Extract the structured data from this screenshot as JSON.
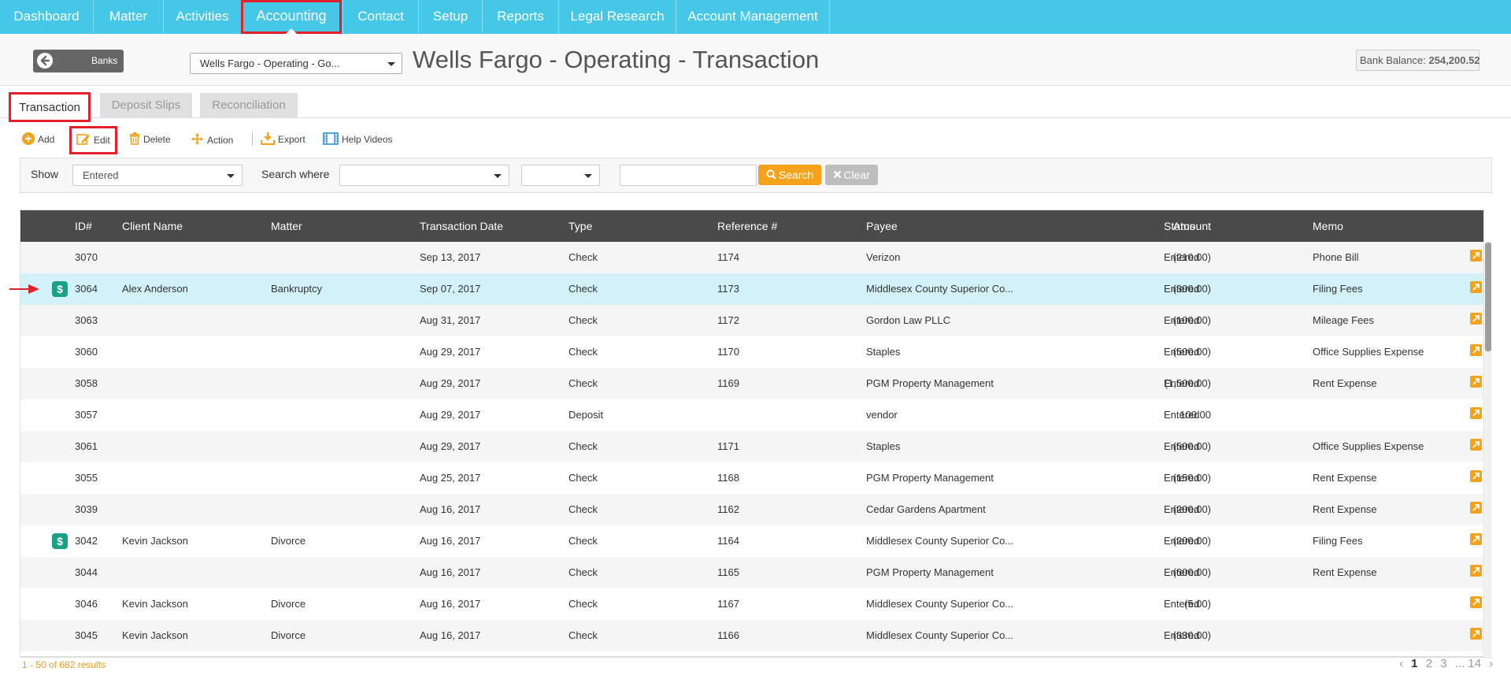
{
  "nav": {
    "items": [
      "Dashboard",
      "Matter",
      "Activities",
      "Accounting",
      "Contact",
      "Setup",
      "Reports",
      "Legal Research",
      "Account Management"
    ],
    "active": "Accounting"
  },
  "header": {
    "back_button": "Banks",
    "account_select": "Wells Fargo - Operating - Go...",
    "title": "Wells Fargo - Operating - Transaction",
    "balance_label": "Bank Balance:",
    "balance_value": "254,200.52"
  },
  "tabs": [
    {
      "label": "Transaction",
      "active": true
    },
    {
      "label": "Deposit Slips",
      "active": false
    },
    {
      "label": "Reconciliation",
      "active": false
    }
  ],
  "toolbar": {
    "add": "Add",
    "edit": "Edit",
    "delete": "Delete",
    "action": "Action",
    "export": "Export",
    "help_videos": "Help Videos"
  },
  "filter": {
    "show_label": "Show",
    "show_value": "Entered",
    "search_where_label": "Search where",
    "search_field_value": "",
    "operator_value": "",
    "search_text": "",
    "search_button": "Search",
    "clear_button": "Clear"
  },
  "table": {
    "columns": [
      "ID#",
      "Client Name",
      "Matter",
      "Transaction Date",
      "Type",
      "Reference #",
      "Payee",
      "Amount",
      "Status",
      "Memo"
    ],
    "rows": [
      {
        "id": "3070",
        "client": "",
        "matter": "",
        "date": "Sep 13, 2017",
        "type": "Check",
        "ref": "1174",
        "payee": "Verizon",
        "amount": "(210.00)",
        "status": "Entered",
        "memo": "Phone Bill",
        "money": false,
        "selected": false
      },
      {
        "id": "3064",
        "client": "Alex Anderson",
        "matter": "Bankruptcy",
        "date": "Sep 07, 2017",
        "type": "Check",
        "ref": "1173",
        "payee": "Middlesex County Superior Co...",
        "amount": "(300.00)",
        "status": "Entered",
        "memo": "Filing Fees",
        "money": true,
        "selected": true
      },
      {
        "id": "3063",
        "client": "",
        "matter": "",
        "date": "Aug 31, 2017",
        "type": "Check",
        "ref": "1172",
        "payee": "Gordon Law PLLC",
        "amount": "(100.00)",
        "status": "Entered",
        "memo": "Mileage Fees",
        "money": false,
        "selected": false
      },
      {
        "id": "3060",
        "client": "",
        "matter": "",
        "date": "Aug 29, 2017",
        "type": "Check",
        "ref": "1170",
        "payee": "Staples",
        "amount": "(500.00)",
        "status": "Entered",
        "memo": "Office Supplies Expense",
        "money": false,
        "selected": false
      },
      {
        "id": "3058",
        "client": "",
        "matter": "",
        "date": "Aug 29, 2017",
        "type": "Check",
        "ref": "1169",
        "payee": "PGM Property Management",
        "amount": "(1,500.00)",
        "status": "Entered",
        "memo": "Rent Expense",
        "money": false,
        "selected": false
      },
      {
        "id": "3057",
        "client": "",
        "matter": "",
        "date": "Aug 29, 2017",
        "type": "Deposit",
        "ref": "",
        "payee": "vendor",
        "amount": "100.00",
        "status": "Entered",
        "memo": "",
        "money": false,
        "selected": false
      },
      {
        "id": "3061",
        "client": "",
        "matter": "",
        "date": "Aug 29, 2017",
        "type": "Check",
        "ref": "1171",
        "payee": "Staples",
        "amount": "(500.00)",
        "status": "Entered",
        "memo": "Office Supplies Expense",
        "money": false,
        "selected": false
      },
      {
        "id": "3055",
        "client": "",
        "matter": "",
        "date": "Aug 25, 2017",
        "type": "Check",
        "ref": "1168",
        "payee": "PGM Property Management",
        "amount": "(150.00)",
        "status": "Entered",
        "memo": "Rent Expense",
        "money": false,
        "selected": false
      },
      {
        "id": "3039",
        "client": "",
        "matter": "",
        "date": "Aug 16, 2017",
        "type": "Check",
        "ref": "1162",
        "payee": "Cedar Gardens Apartment",
        "amount": "(200.00)",
        "status": "Entered",
        "memo": "Rent Expense",
        "money": false,
        "selected": false
      },
      {
        "id": "3042",
        "client": "Kevin Jackson",
        "matter": "Divorce",
        "date": "Aug 16, 2017",
        "type": "Check",
        "ref": "1164",
        "payee": "Middlesex County Superior Co...",
        "amount": "(200.00)",
        "status": "Entered",
        "memo": "Filing Fees",
        "money": true,
        "selected": false
      },
      {
        "id": "3044",
        "client": "",
        "matter": "",
        "date": "Aug 16, 2017",
        "type": "Check",
        "ref": "1165",
        "payee": "PGM Property Management",
        "amount": "(600.00)",
        "status": "Entered",
        "memo": "Rent Expense",
        "money": false,
        "selected": false
      },
      {
        "id": "3046",
        "client": "Kevin Jackson",
        "matter": "Divorce",
        "date": "Aug 16, 2017",
        "type": "Check",
        "ref": "1167",
        "payee": "Middlesex County Superior Co...",
        "amount": "(5.00)",
        "status": "Entered",
        "memo": "",
        "money": false,
        "selected": false
      },
      {
        "id": "3045",
        "client": "Kevin Jackson",
        "matter": "Divorce",
        "date": "Aug 16, 2017",
        "type": "Check",
        "ref": "1166",
        "payee": "Middlesex County Superior Co...",
        "amount": "(330.00)",
        "status": "Entered",
        "memo": "",
        "money": false,
        "selected": false
      }
    ]
  },
  "footer": {
    "result_count": "1 - 50 of 682 results",
    "pages": [
      "1",
      "2",
      "3",
      "...",
      "14"
    ],
    "current_page": "1"
  },
  "icons": {
    "row_money_icon": "money-icon",
    "row_edit_icon": "external-edit-icon"
  },
  "colors": {
    "nav_bg": "#45c8e8",
    "accent_orange": "#f6a21b",
    "highlight_red": "#e0202a",
    "selected_row": "#d3f1f8",
    "grid_header": "#4a4a4a"
  }
}
